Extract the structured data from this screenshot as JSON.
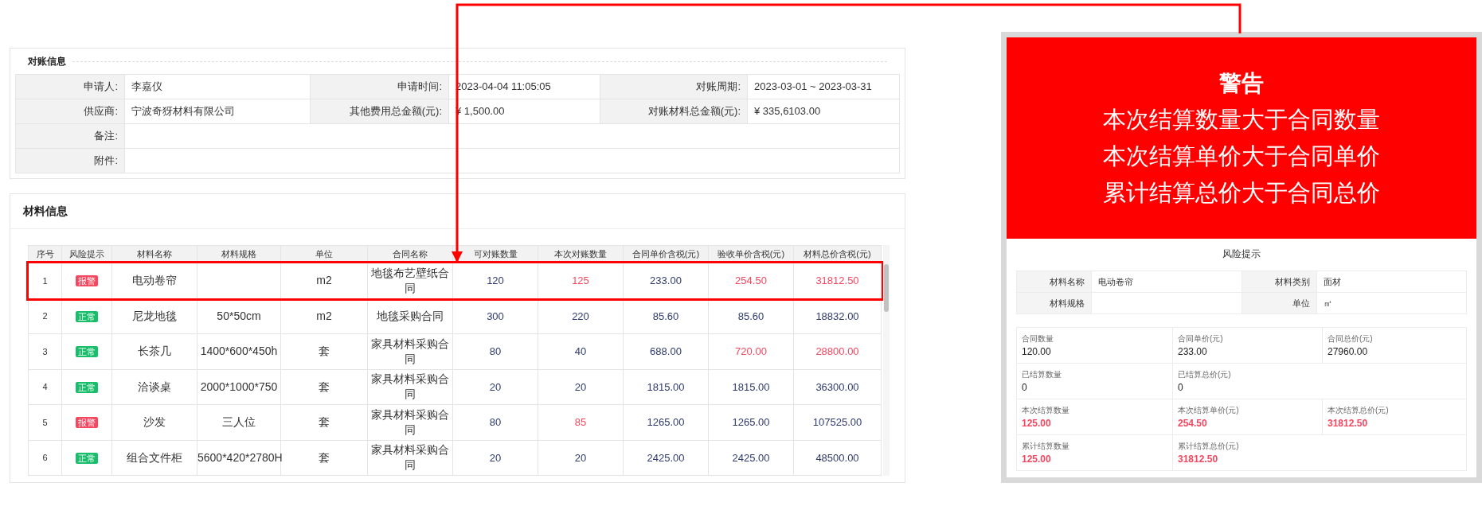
{
  "reconciliation": {
    "title": "对账信息",
    "fields": [
      {
        "label": "申请人:",
        "value": "李嘉仪"
      },
      {
        "label": "申请时间:",
        "value": "2023-04-04 11:05:05"
      },
      {
        "label": "对账周期:",
        "value": "2023-03-01 ~ 2023-03-31"
      },
      {
        "label": "供应商:",
        "value": "宁波奇犽材料有限公司"
      },
      {
        "label": "其他费用总金额(元):",
        "value": "¥ 1,500.00"
      },
      {
        "label": "对账材料总金额(元):",
        "value": "¥ 335,6103.00"
      }
    ],
    "remark": {
      "label": "备注:"
    },
    "attachment": {
      "label": "附件:"
    }
  },
  "materials": {
    "title": "材料信息",
    "columns": [
      "序号",
      "风险提示",
      "材料名称",
      "材料规格",
      "单位",
      "合同名称",
      "可对账数量",
      "本次对账数量",
      "合同单价含税(元)",
      "验收单价含税(元)",
      "材料总价含税(元)"
    ],
    "rows": [
      {
        "selected": true,
        "no": "1",
        "risk": {
          "label": "报警",
          "kind": "alarm"
        },
        "name": "电动卷帘",
        "spec": "",
        "unit": "m2",
        "contract": "地毯布艺壁纸合同",
        "cells": [
          {
            "text": "120",
            "warn": false
          },
          {
            "text": "125",
            "warn": true
          },
          {
            "text": "233.00",
            "warn": false
          },
          {
            "text": "254.50",
            "warn": true
          },
          {
            "text": "31812.50",
            "warn": true
          }
        ]
      },
      {
        "selected": false,
        "no": "2",
        "risk": {
          "label": "正常",
          "kind": "normal"
        },
        "name": "尼龙地毯",
        "spec": "50*50cm",
        "unit": "m2",
        "contract": "地毯采购合同",
        "cells": [
          {
            "text": "300",
            "warn": false
          },
          {
            "text": "220",
            "warn": false
          },
          {
            "text": "85.60",
            "warn": false
          },
          {
            "text": "85.60",
            "warn": false
          },
          {
            "text": "18832.00",
            "warn": false
          }
        ]
      },
      {
        "selected": false,
        "no": "3",
        "risk": {
          "label": "正常",
          "kind": "normal"
        },
        "name": "长茶几",
        "spec": "1400*600*450h",
        "unit": "套",
        "contract": "家具材料采购合同",
        "cells": [
          {
            "text": "80",
            "warn": false
          },
          {
            "text": "40",
            "warn": false
          },
          {
            "text": "688.00",
            "warn": false
          },
          {
            "text": "720.00",
            "warn": true
          },
          {
            "text": "28800.00",
            "warn": true
          }
        ]
      },
      {
        "selected": false,
        "no": "4",
        "risk": {
          "label": "正常",
          "kind": "normal"
        },
        "name": "洽谈桌",
        "spec": "2000*1000*750",
        "unit": "套",
        "contract": "家具材料采购合同",
        "cells": [
          {
            "text": "20",
            "warn": false
          },
          {
            "text": "20",
            "warn": false
          },
          {
            "text": "1815.00",
            "warn": false
          },
          {
            "text": "1815.00",
            "warn": false
          },
          {
            "text": "36300.00",
            "warn": false
          }
        ]
      },
      {
        "selected": false,
        "no": "5",
        "risk": {
          "label": "报警",
          "kind": "alarm"
        },
        "name": "沙发",
        "spec": "三人位",
        "unit": "套",
        "contract": "家具材料采购合同",
        "cells": [
          {
            "text": "80",
            "warn": false
          },
          {
            "text": "85",
            "warn": true
          },
          {
            "text": "1265.00",
            "warn": false
          },
          {
            "text": "1265.00",
            "warn": false
          },
          {
            "text": "107525.00",
            "warn": false
          }
        ]
      },
      {
        "selected": false,
        "no": "6",
        "risk": {
          "label": "正常",
          "kind": "normal"
        },
        "name": "组合文件柜",
        "spec": "5600*420*2780H",
        "unit": "套",
        "contract": "家具材料采购合同",
        "cells": [
          {
            "text": "20",
            "warn": false
          },
          {
            "text": "20",
            "warn": false
          },
          {
            "text": "2425.00",
            "warn": false
          },
          {
            "text": "2425.00",
            "warn": false
          },
          {
            "text": "48500.00",
            "warn": false
          }
        ]
      }
    ]
  },
  "warning": {
    "title": "警告",
    "lines": [
      "本次结算数量大于合同数量",
      "本次结算单价大于合同单价",
      "累计结算总价大于合同总价"
    ]
  },
  "risk_panel": {
    "title": "风险提示",
    "info": [
      {
        "label": "材料名称",
        "value": "电动卷帘"
      },
      {
        "label": "材料类别",
        "value": "面材"
      },
      {
        "label": "材料规格"
      },
      {
        "label": "单位",
        "value": "㎡"
      }
    ],
    "stats": [
      [
        {
          "label": "合同数量",
          "value": "120.00",
          "warn": false
        },
        {
          "label": "合同单价(元)",
          "value": "233.00",
          "warn": false
        },
        {
          "label": "合同总价(元)",
          "value": "27960.00",
          "warn": false
        }
      ],
      [
        {
          "label": "已结算数量",
          "value": "0",
          "warn": false
        },
        {
          "label": "已结算总价(元)",
          "value": "0",
          "warn": false
        }
      ],
      [
        {
          "label": "本次结算数量",
          "value": "125.00",
          "warn": true
        },
        {
          "label": "本次结算单价(元)",
          "value": "254.50",
          "warn": true
        },
        {
          "label": "本次结算总价(元)",
          "value": "31812.50",
          "warn": true
        }
      ],
      [
        {
          "label": "累计结算数量",
          "value": "125.00",
          "warn": true
        },
        {
          "label": "累计结算总价(元)",
          "value": "31812.50",
          "warn": true
        }
      ]
    ]
  }
}
